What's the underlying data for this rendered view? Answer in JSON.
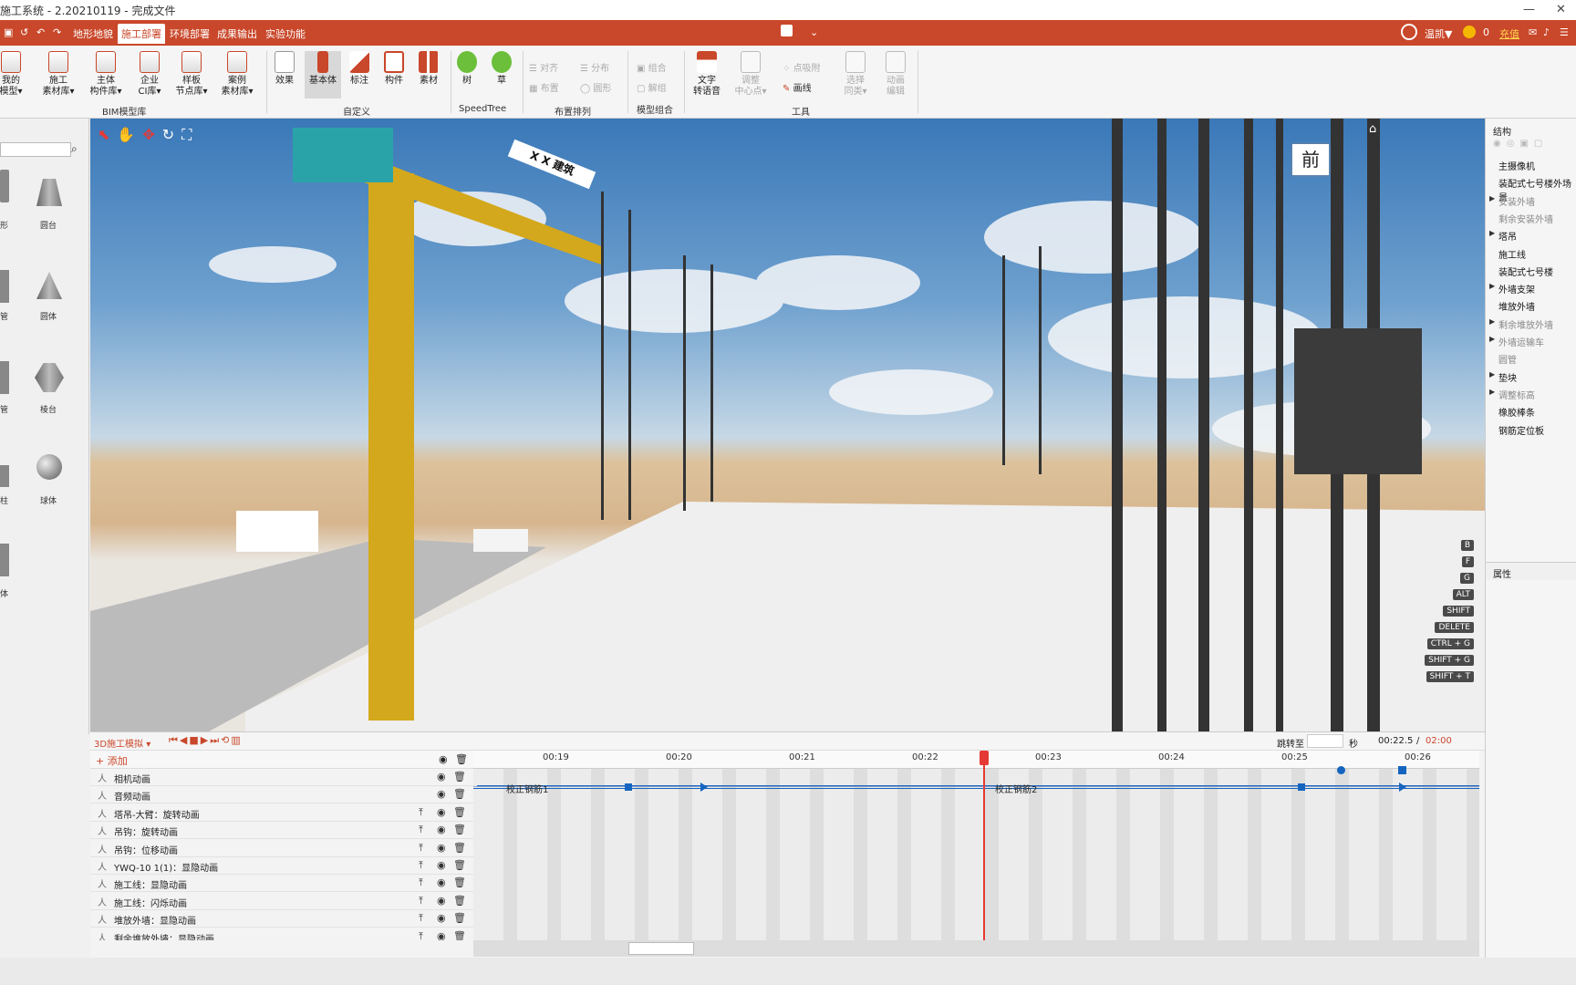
{
  "titlebar": {
    "title": "施工系统 - 2.20210119 - 完成文件"
  },
  "menubar": {
    "tabs": [
      "地形地貌",
      "施工部署",
      "环境部署",
      "成果输出",
      "实验功能"
    ],
    "user_name": "温凯▼",
    "coins": "0",
    "recharge": "充值"
  },
  "ribbon": {
    "buttons": [
      {
        "label": "我的\n模型▾"
      },
      {
        "label": "施工\n素材库▾"
      },
      {
        "label": "主体\n构件库▾"
      },
      {
        "label": "企业\nCI库▾"
      },
      {
        "label": "样板\n节点库▾"
      },
      {
        "label": "案例\n素材库▾"
      },
      {
        "label": "效果"
      },
      {
        "label": "基本体"
      },
      {
        "label": "标注"
      },
      {
        "label": "构件"
      },
      {
        "label": "素材"
      },
      {
        "label": "树"
      },
      {
        "label": "草"
      },
      {
        "label": "文字\n转语音"
      },
      {
        "label": "调整\n中心点▾"
      },
      {
        "label": "选择\n同类▾"
      },
      {
        "label": "动画\n编辑"
      }
    ],
    "small": {
      "align": "对齐",
      "distribute": "分布",
      "layout": "布置",
      "circle": "圆形",
      "combine": "组合",
      "ungroup": "解组",
      "snap": "点吸附",
      "draw_line": "画线"
    },
    "groups": {
      "bim": "BIM模型库",
      "custom": "自定义",
      "speedtree": "SpeedTree",
      "arrange": "布置排列",
      "model_group": "模型组合",
      "tools": "工具"
    }
  },
  "leftpanel": {
    "shapes": [
      "形",
      "圆台",
      "管",
      "圆体",
      "管",
      "棱台",
      "柱",
      "球体",
      "体"
    ]
  },
  "viewport": {
    "crane_sign": "X X 建筑",
    "view_label": "前",
    "shortcuts": [
      "B",
      "F",
      "G",
      "ALT",
      "SHIFT",
      "DELETE",
      "CTRL + G",
      "SHIFT + G",
      "SHIFT + T"
    ]
  },
  "rightpanel": {
    "structure_title": "结构",
    "items": [
      {
        "label": "主摄像机",
        "arrow": ""
      },
      {
        "label": "装配式七号楼外场景",
        "arrow": ""
      },
      {
        "label": "安装外墙",
        "arrow": "▶"
      },
      {
        "label": "剩余安装外墙",
        "arrow": ""
      },
      {
        "label": "塔吊",
        "arrow": "▶"
      },
      {
        "label": "施工线",
        "arrow": ""
      },
      {
        "label": "装配式七号楼",
        "arrow": ""
      },
      {
        "label": "外墙支架",
        "arrow": "▶"
      },
      {
        "label": "堆放外墙",
        "arrow": ""
      },
      {
        "label": "剩余堆放外墙",
        "arrow": "▶"
      },
      {
        "label": "外墙运输车",
        "arrow": "▶"
      },
      {
        "label": "圆管",
        "arrow": ""
      },
      {
        "label": "垫块",
        "arrow": "▶"
      },
      {
        "label": "调整标高",
        "arrow": "▶"
      },
      {
        "label": "橡胶棒条",
        "arrow": ""
      },
      {
        "label": "钢筋定位板",
        "arrow": ""
      }
    ],
    "properties_title": "属性"
  },
  "timeline": {
    "mode": "3D施工模拟 ▾",
    "jump_label": "跳转至",
    "seconds": "秒",
    "current_time": "00:22.5",
    "slash": "/",
    "total_time": "02:00",
    "add": "+ 添加",
    "ticks": [
      "00:19",
      "00:20",
      "00:21",
      "00:22",
      "00:23",
      "00:24",
      "00:25",
      "00:26"
    ],
    "tracks": [
      {
        "name": "相机动画",
        "top": false
      },
      {
        "name": "音频动画",
        "top": false
      },
      {
        "name": "塔吊-大臂：旋转动画",
        "top": true
      },
      {
        "name": "吊钩：旋转动画",
        "top": true
      },
      {
        "name": "吊钩：位移动画",
        "top": true
      },
      {
        "name": "YWQ-10 1(1)：显隐动画",
        "top": true
      },
      {
        "name": "施工线：显隐动画",
        "top": true
      },
      {
        "name": "施工线：闪烁动画",
        "top": true
      },
      {
        "name": "堆放外墙：显隐动画",
        "top": true
      },
      {
        "name": "剩余堆放外墙：显隐动画",
        "top": true
      }
    ],
    "clips": [
      "校正钢筋1",
      "校正钢筋2"
    ]
  },
  "colors": {
    "accent": "#c9472a",
    "key": "#1565c0",
    "playhead": "#e53935"
  }
}
